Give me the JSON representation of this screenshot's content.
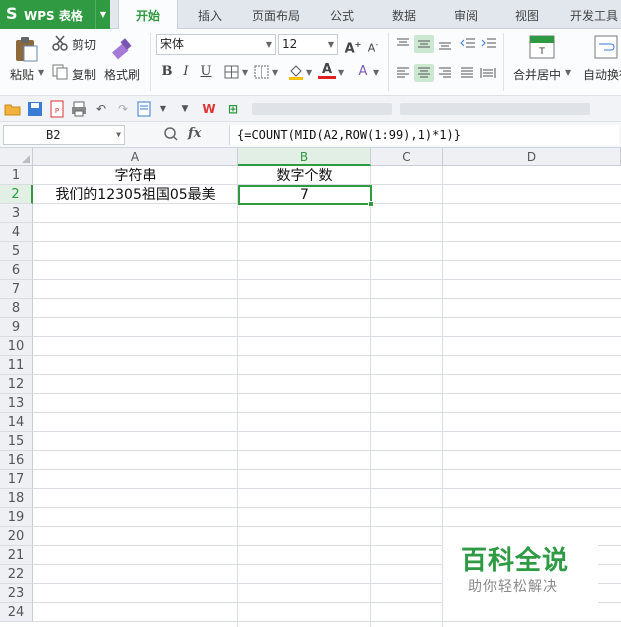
{
  "app": {
    "logo": "S",
    "name": "WPS 表格"
  },
  "tabs": [
    "开始",
    "插入",
    "页面布局",
    "公式",
    "数据",
    "审阅",
    "视图",
    "开发工具"
  ],
  "ribbon": {
    "paste": "粘贴",
    "cut": "剪切",
    "copy": "复制",
    "format_painter": "格式刷",
    "font_name": "宋体",
    "font_size": "12",
    "bold": "B",
    "italic": "I",
    "underline": "U",
    "font_color_glyph": "A",
    "merge_center": "合并居中",
    "wrap_text": "自动换行"
  },
  "formula_bar": {
    "name_box": "B2",
    "fx": "fx",
    "formula": "{=COUNT(MID(A2,ROW(1:99),1)*1)}"
  },
  "columns": [
    "A",
    "B",
    "C",
    "D"
  ],
  "rows": [
    "1",
    "2",
    "3",
    "4",
    "5",
    "6",
    "7",
    "8",
    "9",
    "10",
    "11",
    "12",
    "13",
    "14",
    "15",
    "16",
    "17",
    "18",
    "19",
    "20",
    "21",
    "22",
    "23",
    "24"
  ],
  "cells": {
    "A1": "字符串",
    "B1": "数字个数",
    "A2": "我们的12305祖国05最美",
    "B2": "7"
  },
  "watermark": {
    "title": "百科全说",
    "subtitle": "助你轻松解决"
  },
  "colors": {
    "accent": "#2f9a41",
    "grid": "#dadee3",
    "header_bg": "#eef0f3"
  }
}
